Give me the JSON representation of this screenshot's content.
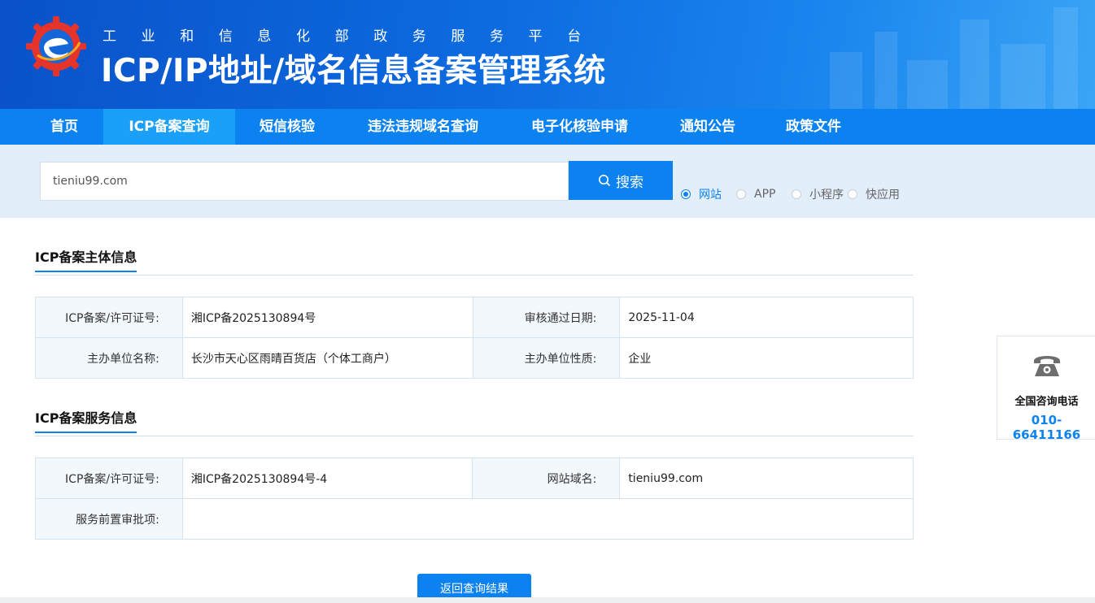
{
  "header": {
    "subtitle": "工业和信息化部政务服务平台",
    "title": "ICP/IP地址/域名信息备案管理系统"
  },
  "nav": {
    "items": [
      {
        "label": "首页"
      },
      {
        "label": "ICP备案查询"
      },
      {
        "label": "短信核验"
      },
      {
        "label": "违法违规域名查询"
      },
      {
        "label": "电子化核验申请"
      },
      {
        "label": "通知公告"
      },
      {
        "label": "政策文件"
      }
    ],
    "active_index": 1
  },
  "search": {
    "value": "tieniu99.com",
    "button_label": "搜索",
    "types": [
      {
        "label": "网站",
        "checked": true
      },
      {
        "label": "APP",
        "checked": false
      },
      {
        "label": "小程序",
        "checked": false
      },
      {
        "label": "快应用",
        "checked": false
      }
    ]
  },
  "subject_info": {
    "title": "ICP备案主体信息",
    "rows": [
      {
        "label1": "ICP备案/许可证号:",
        "value1": "湘ICP备2025130894号",
        "label2": "审核通过日期:",
        "value2": "2025-11-04"
      },
      {
        "label1": "主办单位名称:",
        "value1": "长沙市天心区雨晴百货店（个体工商户）",
        "label2": "主办单位性质:",
        "value2": "企业"
      }
    ]
  },
  "service_info": {
    "title": "ICP备案服务信息",
    "license_label": "ICP备案/许可证号:",
    "license_value": "湘ICP备2025130894号-4",
    "domain_label": "网站域名:",
    "domain_value": "tieniu99.com",
    "approval_label": "服务前置审批项:",
    "approval_value": ""
  },
  "back_button": "返回查询结果",
  "contact": {
    "label": "全国咨询电话",
    "phone": "010-66411166"
  },
  "colors": {
    "primary": "#0b82f0",
    "header_dark": "#0a52c9",
    "nav_active": "#1aa0f8",
    "logo_red": "#e6342a"
  }
}
